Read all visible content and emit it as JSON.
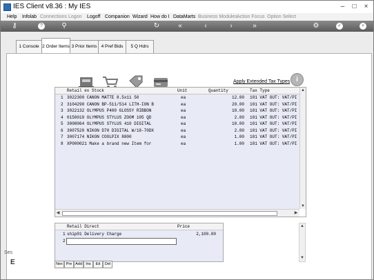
{
  "window": {
    "title": "IES Client v8.36 : My IES",
    "controls": [
      "–",
      "□",
      "×"
    ]
  },
  "menubar": [
    {
      "label": "Help",
      "enabled": true
    },
    {
      "label": "Infolab",
      "enabled": true
    },
    {
      "label": "Connections",
      "enabled": false
    },
    {
      "label": "Logon",
      "enabled": false
    },
    {
      "label": "Logoff",
      "enabled": true
    },
    {
      "label": "Companion",
      "enabled": true
    },
    {
      "label": "Wizard",
      "enabled": true
    },
    {
      "label": "How do I",
      "enabled": true
    },
    {
      "label": "DataMarts",
      "enabled": true
    },
    {
      "label": "Business Modules",
      "enabled": false
    },
    {
      "label": "Action Focus",
      "enabled": false
    },
    {
      "label": "Option Select",
      "enabled": false
    }
  ],
  "toolbar": {
    "icons": [
      "key-icon",
      "help-icon",
      "search-icon",
      "refresh-icon",
      "rewind-icon",
      "back-icon",
      "forward-icon",
      "fast-forward-icon",
      "settings-icon",
      "confirm-icon",
      "add-icon"
    ],
    "glyphs": {
      "key": "⚷",
      "help": "?",
      "search": "⚲",
      "refresh": "↻",
      "rewind": "«",
      "back": "‹",
      "forward": "›",
      "fastforward": "»",
      "settings": "⚙",
      "confirm": "✓",
      "add": "+"
    }
  },
  "tabs": [
    {
      "label": "1 Console",
      "active": false
    },
    {
      "label": "2 Order Items",
      "active": true
    },
    {
      "label": "3 Prior Items",
      "active": false
    },
    {
      "label": "4 Pref Bids",
      "active": false
    },
    {
      "label": "5 Q Hdrs",
      "active": false
    }
  ],
  "actions": {
    "icons": [
      "register-icon",
      "cart-icon",
      "price-tag-icon",
      "card-icon"
    ],
    "extended_tax_link": "Apply Extended Tax Types",
    "info_glyph": "i"
  },
  "items_grid": {
    "headers": {
      "stock": "Retail ex Stock",
      "unit": "Unit",
      "quantity": "Quantity",
      "tax": "Tax Type"
    },
    "rows": [
      {
        "num": "1",
        "stock": "3022300 CANON MATTE 8.5x11 50",
        "unit": "ea",
        "qty": "12.00",
        "tax": "101 VAT OUT: VAT/PI"
      },
      {
        "num": "2",
        "stock": "3104290 CANON BP-511/514 LITH-ION B",
        "unit": "ea",
        "qty": "20.00",
        "tax": "101 VAT OUT: VAT/PI"
      },
      {
        "num": "3",
        "stock": "3022132 OLYMPUS P400 GLOSSY RIBBON",
        "unit": "ea",
        "qty": "10.00",
        "tax": "101 VAT OUT: VAT/PI"
      },
      {
        "num": "4",
        "stock": "0150019 OLYMPUS STYLUS ZOOM 105 QD",
        "unit": "ea",
        "qty": "2.00",
        "tax": "101 VAT OUT: VAT/PI"
      },
      {
        "num": "5",
        "stock": "3008064 OLYMPUS STYLUS 410 DIGITAL",
        "unit": "ea",
        "qty": "10.00",
        "tax": "101 VAT OUT: VAT/PI"
      },
      {
        "num": "6",
        "stock": "3007520 NIKON D70 DIGITAL W/18-70DX",
        "unit": "ea",
        "qty": "2.00",
        "tax": "101 VAT OUT: VAT/PI"
      },
      {
        "num": "7",
        "stock": "3007174 NIKON COOLPIX 8800",
        "unit": "ea",
        "qty": "1.00",
        "tax": "101 VAT OUT: VAT/PI"
      },
      {
        "num": "8",
        "stock": "XP000021 Make a brand new Item for",
        "unit": "ea",
        "qty": "1.00",
        "tax": "101 VAT OUT: VAT/PI"
      }
    ]
  },
  "direct_grid": {
    "headers": {
      "direct": "Retail Direct",
      "price": "Price"
    },
    "rows": [
      {
        "num": "1",
        "desc": "ship01 Delivery Charge",
        "price": "2,100.00"
      },
      {
        "num": "2",
        "desc": "",
        "price": ""
      }
    ]
  },
  "nav_buttons": [
    "Nex",
    "Pre",
    "Add",
    "Ins",
    "Ed",
    "Del"
  ],
  "side_labels": [
    "Ses",
    "E"
  ]
}
